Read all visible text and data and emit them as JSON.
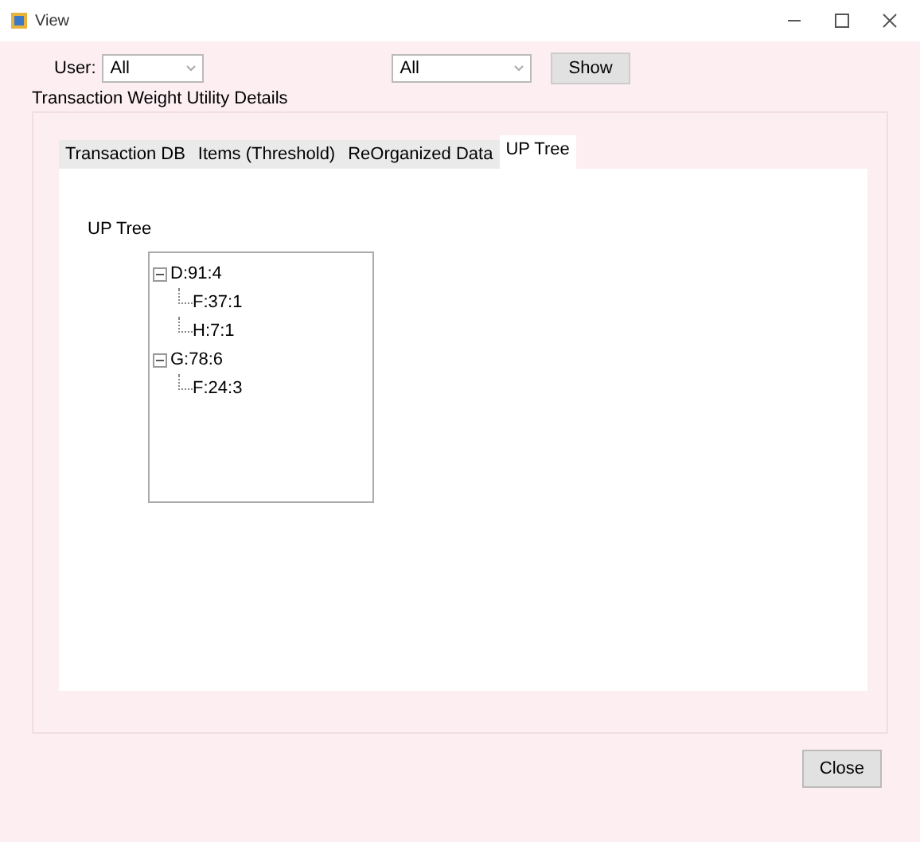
{
  "window": {
    "title": "View"
  },
  "filters": {
    "user_label": "User:",
    "user_value": "All",
    "second_value": "All",
    "show_button": "Show"
  },
  "group": {
    "title": "Transaction Weight Utility Details"
  },
  "tabs": [
    {
      "label": "Transaction DB",
      "selected": false
    },
    {
      "label": "Items (Threshold)",
      "selected": false
    },
    {
      "label": "ReOrganized Data",
      "selected": false
    },
    {
      "label": "UP Tree",
      "selected": true
    }
  ],
  "tree_label": "UP Tree",
  "tree": [
    {
      "label": "D:91:4",
      "expanded": true,
      "children": [
        {
          "label": "F:37:1"
        },
        {
          "label": "H:7:1"
        }
      ]
    },
    {
      "label": "G:78:6",
      "expanded": true,
      "children": [
        {
          "label": "F:24:3"
        }
      ]
    }
  ],
  "close_button": "Close"
}
